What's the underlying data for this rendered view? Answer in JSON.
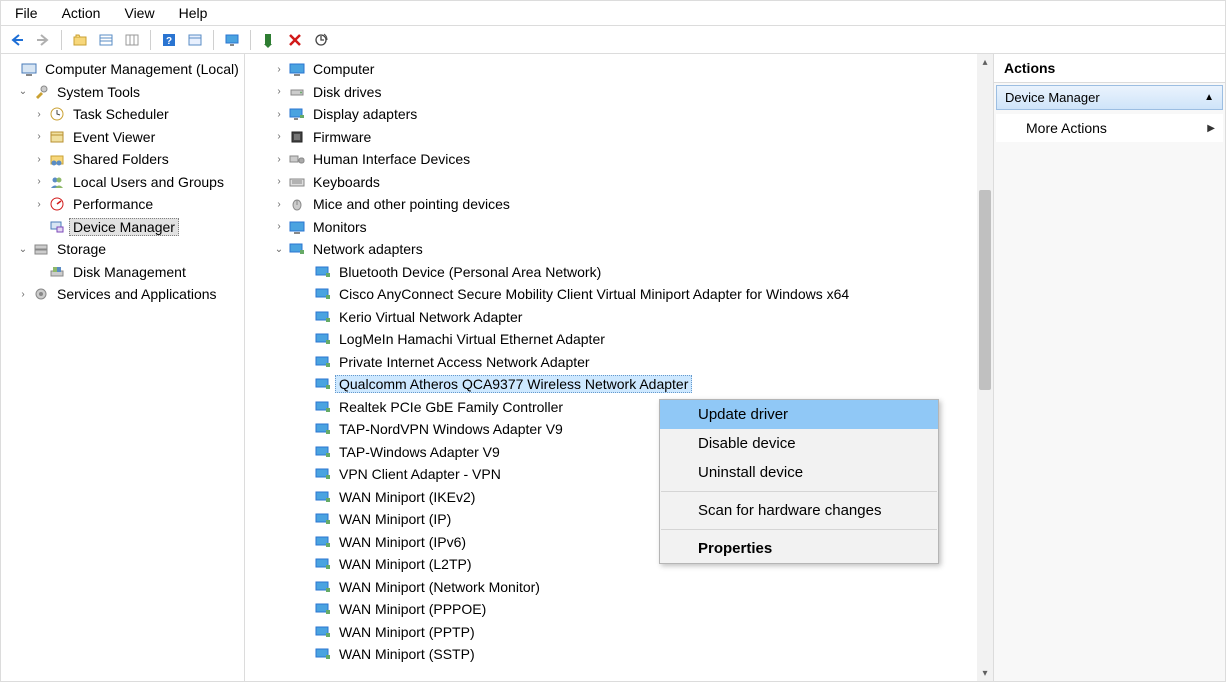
{
  "menubar": {
    "file": "File",
    "action": "Action",
    "view": "View",
    "help": "Help"
  },
  "toolbar_icons": {
    "back": "back-arrow-icon",
    "forward": "forward-arrow-icon",
    "folder": "folder-up-icon",
    "list": "list-view-icon",
    "columns": "columns-icon",
    "help": "help-icon",
    "properties": "properties-icon",
    "monitor": "monitor-icon",
    "enable": "enable-device-icon",
    "delete": "delete-x-icon",
    "scan": "scan-hardware-icon"
  },
  "left_tree": {
    "root": "Computer Management (Local)",
    "system_tools": "System Tools",
    "system_tools_children": {
      "task_scheduler": "Task Scheduler",
      "event_viewer": "Event Viewer",
      "shared_folders": "Shared Folders",
      "local_users": "Local Users and Groups",
      "performance": "Performance",
      "device_manager": "Device Manager"
    },
    "storage": "Storage",
    "storage_children": {
      "disk_management": "Disk Management"
    },
    "services": "Services and Applications"
  },
  "middle_tree": {
    "computer": "Computer",
    "disk_drives": "Disk drives",
    "display_adapters": "Display adapters",
    "firmware": "Firmware",
    "hid": "Human Interface Devices",
    "keyboards": "Keyboards",
    "mice": "Mice and other pointing devices",
    "monitors": "Monitors",
    "network_adapters": "Network adapters",
    "adapters": {
      "bluetooth": "Bluetooth Device (Personal Area Network)",
      "cisco": "Cisco AnyConnect Secure Mobility Client Virtual Miniport Adapter for Windows x64",
      "kerio": "Kerio Virtual Network Adapter",
      "logmein": "LogMeIn Hamachi Virtual Ethernet Adapter",
      "pia": "Private Internet Access Network Adapter",
      "qualcomm": "Qualcomm Atheros QCA9377 Wireless Network Adapter",
      "realtek": "Realtek PCIe GbE Family Controller",
      "tapnord": "TAP-NordVPN Windows Adapter V9",
      "tapwin": "TAP-Windows Adapter V9",
      "vpnclient": "VPN Client Adapter - VPN",
      "wan_ikev2": "WAN Miniport (IKEv2)",
      "wan_ip": "WAN Miniport (IP)",
      "wan_ipv6": "WAN Miniport (IPv6)",
      "wan_l2tp": "WAN Miniport (L2TP)",
      "wan_netmon": "WAN Miniport (Network Monitor)",
      "wan_pppoe": "WAN Miniport (PPPOE)",
      "wan_pptp": "WAN Miniport (PPTP)",
      "wan_sstp": "WAN Miniport (SSTP)"
    }
  },
  "context_menu": {
    "update_driver": "Update driver",
    "disable_device": "Disable device",
    "uninstall_device": "Uninstall device",
    "scan_hw": "Scan for hardware changes",
    "properties": "Properties"
  },
  "actions": {
    "header": "Actions",
    "section": "Device Manager",
    "more_actions": "More Actions"
  }
}
